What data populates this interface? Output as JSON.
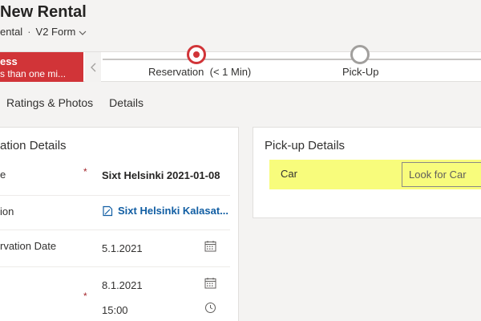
{
  "header": {
    "title": "New Rental",
    "entity": "ental",
    "form_name": "V2 Form"
  },
  "bpf": {
    "flag_title": "ess",
    "flag_subtitle": "s than one mi...",
    "stages": [
      {
        "label": "Reservation",
        "duration": "(< 1 Min)",
        "status": "active"
      },
      {
        "label": "Pick-Up",
        "status": "inactive"
      }
    ]
  },
  "tabs": [
    "Ratings & Photos",
    "Details"
  ],
  "reservation_section": {
    "title": "ation Details",
    "rows": [
      {
        "label": "e",
        "required": "*",
        "value": "Sixt Helsinki 2021-01-08"
      },
      {
        "label": "ion",
        "link_value": "Sixt Helsinki Kalasat..."
      },
      {
        "label": "rvation Date",
        "value": "5.1.2021"
      },
      {
        "date_value": "8.1.2021",
        "required": "*",
        "time_value": "15:00"
      }
    ]
  },
  "pickup_section": {
    "title": "Pick-up Details",
    "car_label": "Car",
    "car_placeholder": "Look for Car"
  },
  "colors": {
    "accent_red": "#d13438",
    "link_blue": "#115ea3",
    "highlight_yellow": "#f8fc7c"
  }
}
